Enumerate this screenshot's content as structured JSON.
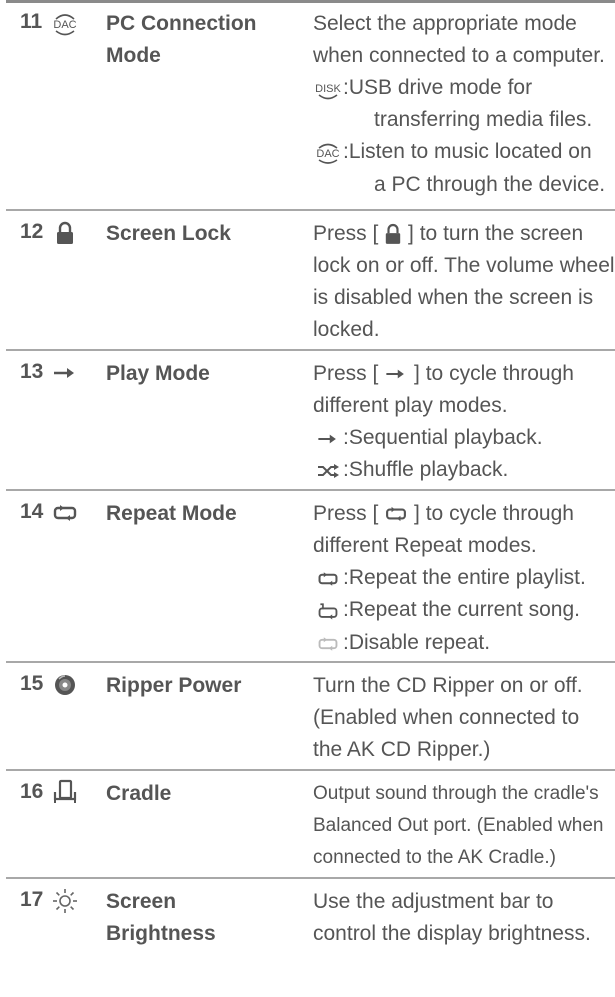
{
  "rows": [
    {
      "number": "11",
      "icon": "dac-icon",
      "name": [
        "PC Connection",
        "Mode"
      ],
      "desc": [
        "Select the appropriate mode",
        "when connected to a computer."
      ],
      "options": [
        {
          "icon": "disk-icon",
          "lines": [
            ":USB drive mode for",
            "transferring media files."
          ]
        },
        {
          "icon": "dac-icon",
          "lines": [
            ":Listen to music located on",
            "a PC through the device."
          ]
        }
      ]
    },
    {
      "number": "12",
      "icon": "lock-icon",
      "name": [
        "Screen Lock"
      ],
      "desc_pre": "Press [",
      "desc_post": "] to turn the screen",
      "desc": [
        "lock on or off. The volume wheel",
        "is disabled when the screen is",
        "locked."
      ]
    },
    {
      "number": "13",
      "icon": "arrow-right-icon",
      "name": [
        "Play Mode"
      ],
      "desc_pre": "Press [",
      "desc_post": "] to cycle through",
      "desc": [
        "different play modes."
      ],
      "options": [
        {
          "icon": "arrow-right-icon",
          "lines": [
            ":Sequential playback."
          ]
        },
        {
          "icon": "shuffle-icon",
          "lines": [
            ":Shuffle playback."
          ]
        }
      ]
    },
    {
      "number": "14",
      "icon": "repeat-icon",
      "name": [
        "Repeat Mode"
      ],
      "desc_pre": "Press [",
      "desc_post": "] to cycle through",
      "desc": [
        "different Repeat modes."
      ],
      "options": [
        {
          "icon": "repeat-icon",
          "lines": [
            ":Repeat the entire playlist."
          ]
        },
        {
          "icon": "repeat-one-icon",
          "lines": [
            ":Repeat the current song."
          ]
        },
        {
          "icon": "repeat-off-icon",
          "lines": [
            ":Disable repeat."
          ]
        }
      ]
    },
    {
      "number": "15",
      "icon": "disc-icon",
      "name": [
        "Ripper Power"
      ],
      "desc": [
        "Turn the CD Ripper on or off.",
        "(Enabled when connected to",
        "the AK CD Ripper.)"
      ]
    },
    {
      "number": "16",
      "icon": "cradle-icon",
      "name": [
        "Cradle"
      ],
      "desc": [
        "Output sound through the cradle's",
        "Balanced Out port. (Enabled when",
        "connected to the AK Cradle.)"
      ]
    },
    {
      "number": "17",
      "icon": "brightness-icon",
      "name": [
        "Screen",
        "Brightness"
      ],
      "desc": [
        "Use the adjustment bar to",
        "control the display brightness."
      ]
    }
  ]
}
